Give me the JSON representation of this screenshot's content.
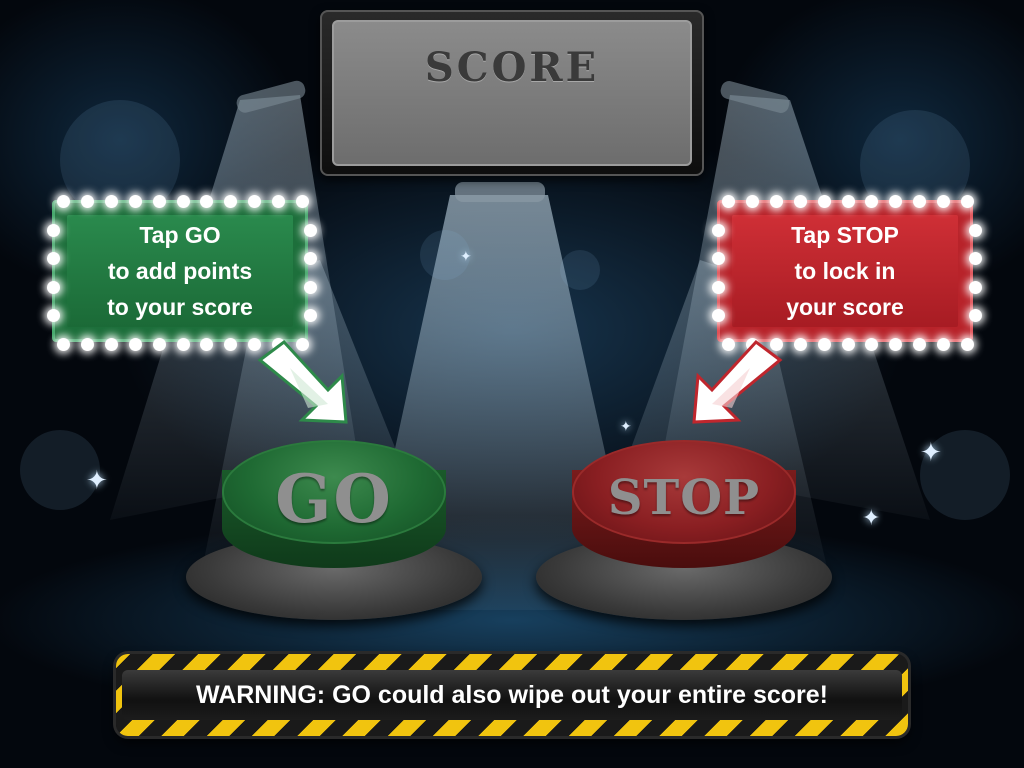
{
  "score_panel": {
    "title": "SCORE",
    "value": ""
  },
  "go_sign": {
    "lines": [
      "Tap GO",
      "to add points",
      "to your score"
    ],
    "color": "#1f7a3d"
  },
  "stop_sign": {
    "lines": [
      "Tap STOP",
      "to lock in",
      "your score"
    ],
    "color": "#c0262d"
  },
  "go_button": {
    "label": "GO",
    "color": "#1f6a33"
  },
  "stop_button": {
    "label": "STOP",
    "color": "#8a1f22"
  },
  "warning": {
    "text": "WARNING: GO could also wipe out your entire score!",
    "stripe_color": "#f1c40f"
  },
  "icons": [
    "go-arrow-icon",
    "stop-arrow-icon",
    "sparkle-icon"
  ]
}
